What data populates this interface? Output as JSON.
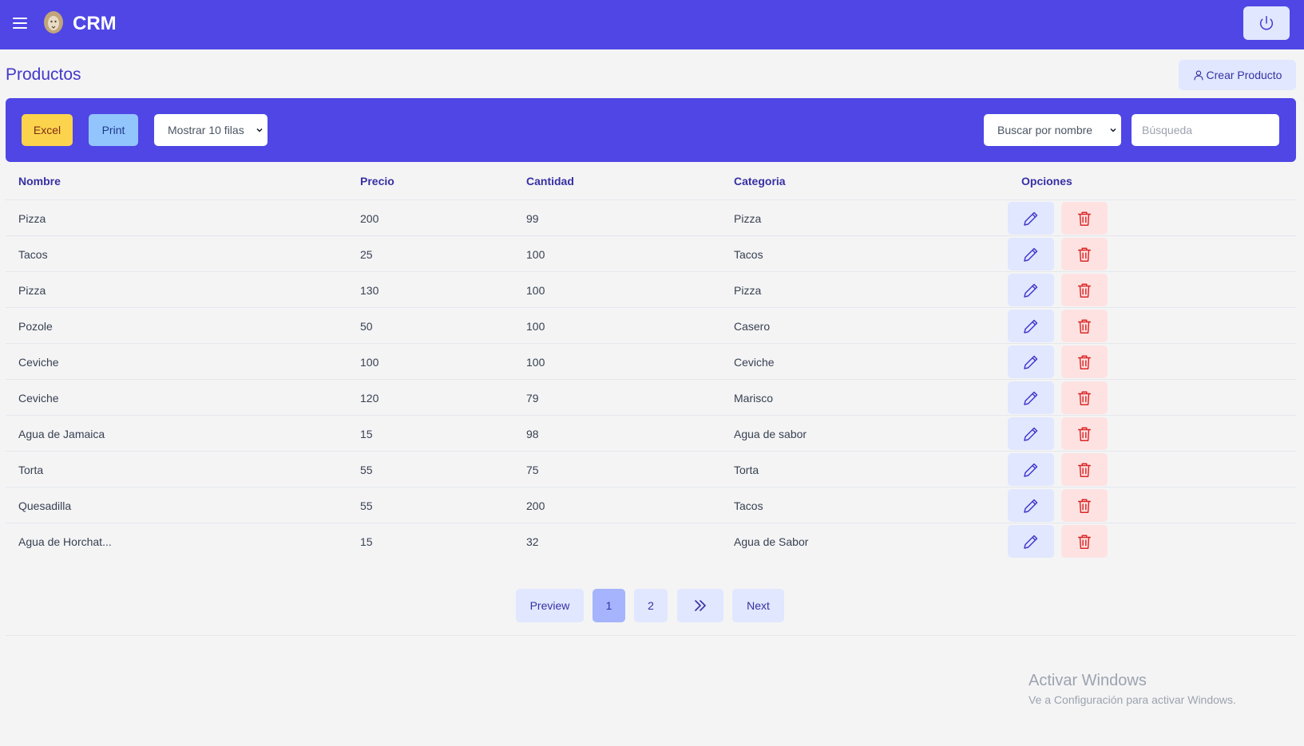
{
  "header": {
    "brand": "CRM",
    "menu_icon": "hamburger-menu-icon",
    "logo_icon": "lion-logo",
    "power_icon": "power-icon"
  },
  "page": {
    "title": "Productos",
    "create_button": "Crear Producto",
    "create_icon": "user-icon"
  },
  "toolbar": {
    "excel_label": "Excel",
    "print_label": "Print",
    "rows_select": "Mostrar 10 filas",
    "search_by_select": "Buscar por nombre",
    "search_placeholder": "Búsqueda",
    "search_value": ""
  },
  "table": {
    "columns": [
      "Nombre",
      "Precio",
      "Cantidad",
      "Categoria",
      "Opciones"
    ],
    "rows": [
      {
        "nombre": "Pizza",
        "precio": "200",
        "cantidad": "99",
        "categoria": "Pizza"
      },
      {
        "nombre": "Tacos",
        "precio": "25",
        "cantidad": "100",
        "categoria": "Tacos"
      },
      {
        "nombre": "Pizza",
        "precio": "130",
        "cantidad": "100",
        "categoria": "Pizza"
      },
      {
        "nombre": "Pozole",
        "precio": "50",
        "cantidad": "100",
        "categoria": "Casero"
      },
      {
        "nombre": "Ceviche",
        "precio": "100",
        "cantidad": "100",
        "categoria": "Ceviche"
      },
      {
        "nombre": "Ceviche",
        "precio": "120",
        "cantidad": "79",
        "categoria": "Marisco"
      },
      {
        "nombre": "Agua de Jamaica",
        "precio": "15",
        "cantidad": "98",
        "categoria": "Agua de sabor"
      },
      {
        "nombre": "Torta",
        "precio": "55",
        "cantidad": "75",
        "categoria": "Torta"
      },
      {
        "nombre": "Quesadilla",
        "precio": "55",
        "cantidad": "200",
        "categoria": "Tacos"
      },
      {
        "nombre": "Agua de Horchat...",
        "precio": "15",
        "cantidad": "32",
        "categoria": "Agua de Sabor"
      }
    ],
    "edit_icon": "pencil-icon",
    "delete_icon": "trash-icon"
  },
  "pagination": {
    "prev_label": "Preview",
    "pages": [
      "1",
      "2"
    ],
    "current_page": "1",
    "last_icon": "double-chevron-right-icon",
    "next_label": "Next"
  },
  "watermark": {
    "line1": "Activar Windows",
    "line2": "Ve a Configuración para activar Windows."
  },
  "colors": {
    "primary": "#4f46e5",
    "accent_light": "#e0e7ff",
    "excel": "#fcd34d",
    "print": "#93c5fd",
    "danger_light": "#fee2e2",
    "danger": "#dc2626"
  }
}
